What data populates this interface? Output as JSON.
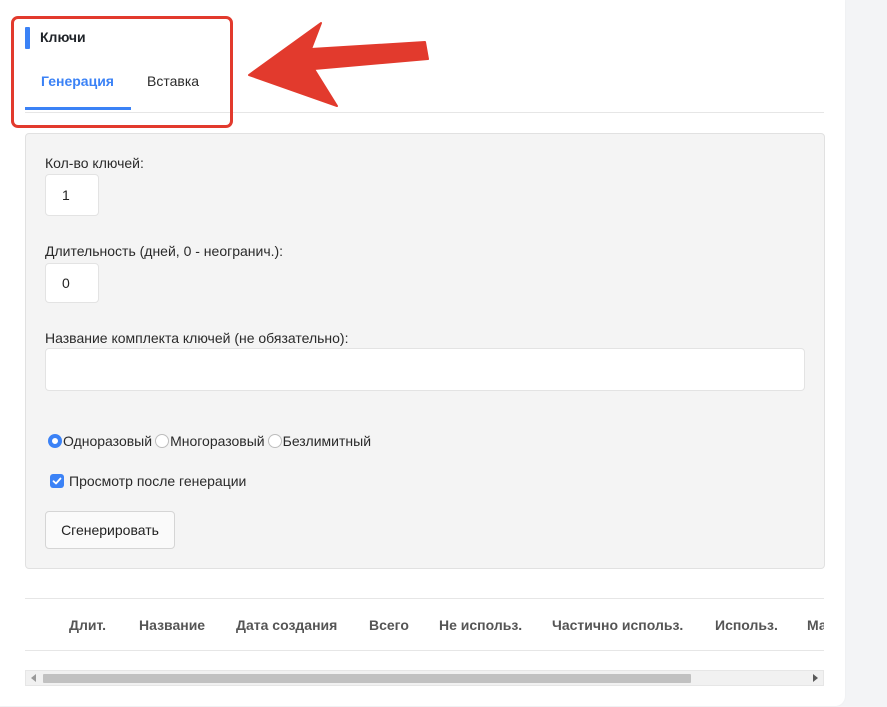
{
  "section": {
    "title": "Ключи"
  },
  "tabs": [
    {
      "label": "Генерация",
      "active": true
    },
    {
      "label": "Вставка",
      "active": false
    }
  ],
  "form": {
    "keys_count": {
      "label": "Кол-во ключей:",
      "value": "1"
    },
    "duration": {
      "label": "Длительность (дней, 0 - неогранич.):",
      "value": "0"
    },
    "set_name": {
      "label": "Название комплекта ключей (не обязательно):",
      "value": ""
    },
    "key_type": {
      "options": [
        "Одноразовый",
        "Многоразовый",
        "Безлимитный"
      ],
      "selected": "Одноразовый"
    },
    "preview_after": {
      "label": "Просмотр после генерации",
      "checked": true
    },
    "generate_button": "Сгенерировать"
  },
  "table": {
    "columns": [
      "Длит.",
      "Название",
      "Дата создания",
      "Всего",
      "Не использ.",
      "Частично использ.",
      "Использ.",
      "Ма"
    ]
  },
  "colors": {
    "accent": "#3b82f6",
    "annotation": "#e23a2d"
  },
  "annotation": {
    "icon": "red-arrow-icon"
  }
}
